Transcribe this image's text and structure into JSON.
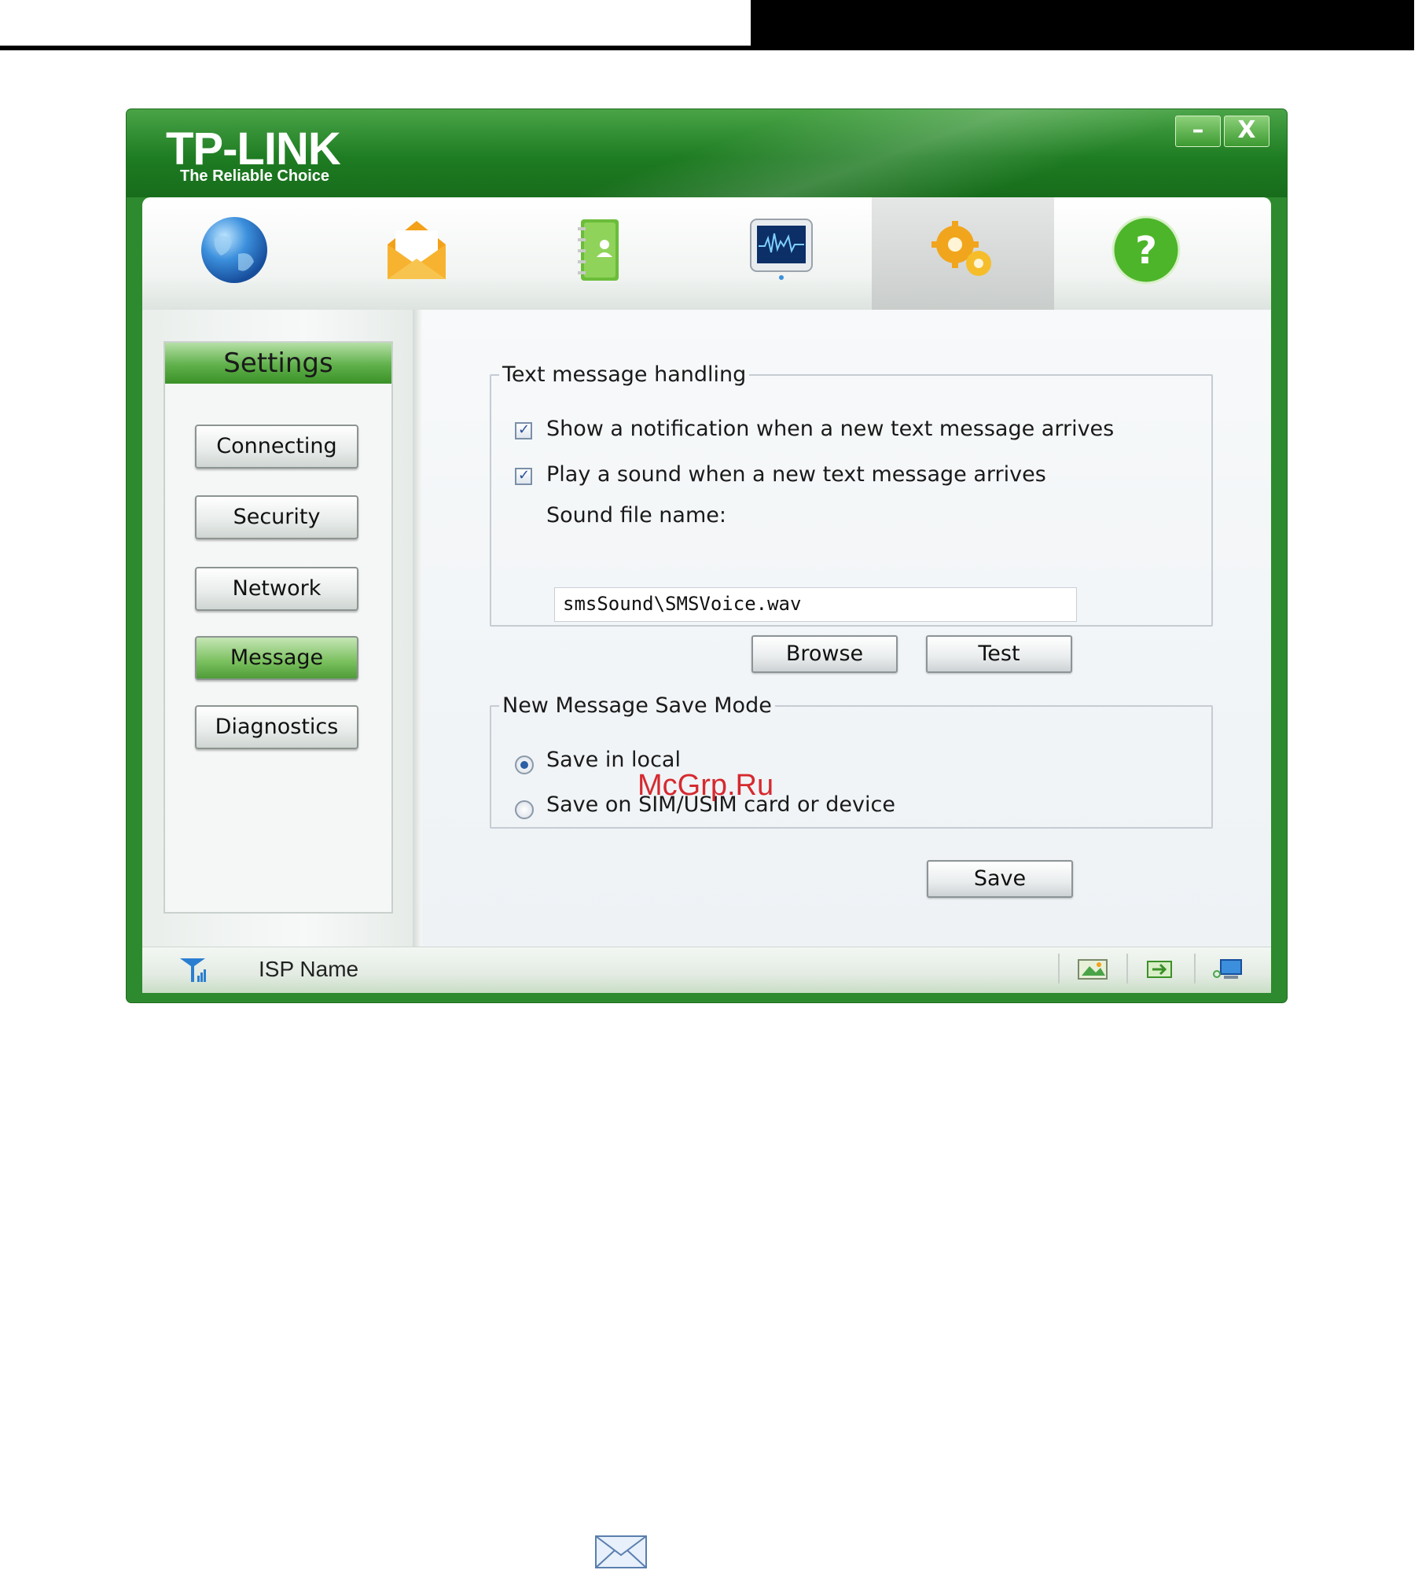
{
  "window": {
    "brand": "TP-LINK",
    "tagline": "The Reliable Choice",
    "minimize_label": "–",
    "close_label": "X"
  },
  "toolbar": {
    "items": [
      {
        "icon": "globe-icon"
      },
      {
        "icon": "envelope-icon"
      },
      {
        "icon": "address-book-icon"
      },
      {
        "icon": "monitor-icon"
      },
      {
        "icon": "gears-icon",
        "active": true
      },
      {
        "icon": "help-icon"
      }
    ]
  },
  "sidebar": {
    "title": "Settings",
    "items": [
      {
        "label": "Connecting"
      },
      {
        "label": "Security"
      },
      {
        "label": "Network"
      },
      {
        "label": "Message",
        "active": true
      },
      {
        "label": "Diagnostics"
      }
    ]
  },
  "text_message": {
    "legend": "Text message handling",
    "notify_label": "Show a notification when a new text message arrives",
    "notify_checked": true,
    "sound_label": "Play a sound when a new text message arrives",
    "sound_checked": true,
    "sound_file_label": "Sound file name:",
    "sound_file_value": "smsSound\\SMSVoice.wav",
    "browse_label": "Browse",
    "test_label": "Test"
  },
  "save_mode": {
    "legend": "New Message Save Mode",
    "local_label": "Save in local",
    "local_selected": true,
    "sim_label": "Save on SIM/USIM card or device",
    "sim_selected": false
  },
  "save_label": "Save",
  "status": {
    "isp_name": "ISP Name",
    "icons": [
      "signal-icon",
      "picture-icon",
      "battery-icon",
      "network-computer-icon"
    ]
  },
  "watermark": "McGrp.Ru",
  "colors": {
    "brand_green": "#1e7c22",
    "active_green": "#5fb04a"
  }
}
